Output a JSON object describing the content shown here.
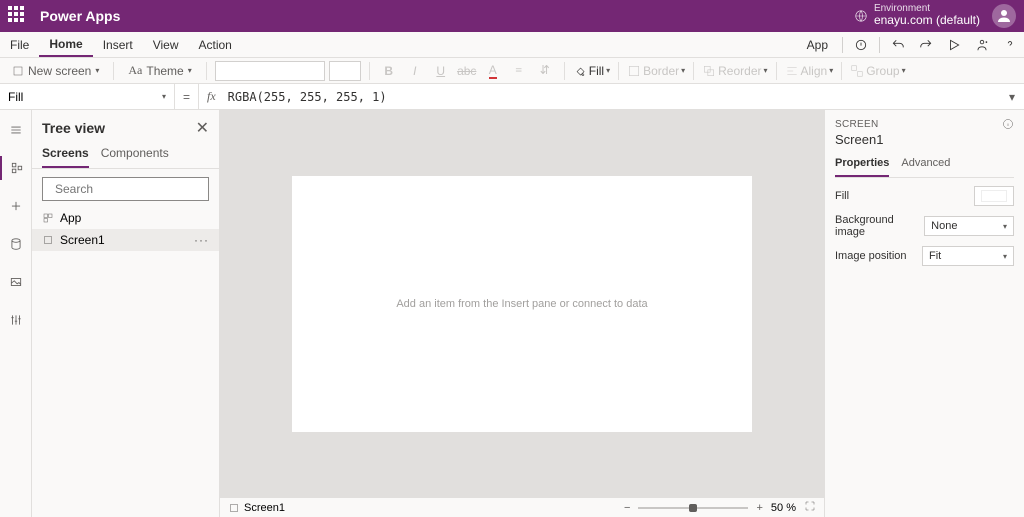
{
  "titlebar": {
    "brand": "Power Apps",
    "env_label": "Environment",
    "env_name": "enayu.com (default)"
  },
  "menubar": {
    "items": [
      "File",
      "Home",
      "Insert",
      "View",
      "Action"
    ],
    "active": 1,
    "app": "App"
  },
  "toolbar": {
    "new_screen": "New screen",
    "theme": "Theme",
    "fill": "Fill",
    "border": "Border",
    "reorder": "Reorder",
    "align": "Align",
    "group": "Group"
  },
  "formula": {
    "prop": "Fill",
    "fx": "fx",
    "value": "RGBA(255, 255, 255, 1)"
  },
  "tree": {
    "title": "Tree view",
    "tabs": [
      "Screens",
      "Components"
    ],
    "search_placeholder": "Search",
    "nodes": [
      "App",
      "Screen1"
    ]
  },
  "canvas": {
    "hint": "Add an item from the Insert pane or connect to data"
  },
  "status": {
    "screen": "Screen1",
    "zoom": "50 %"
  },
  "props": {
    "heading": "SCREEN",
    "name": "Screen1",
    "tabs": [
      "Properties",
      "Advanced"
    ],
    "fill": "Fill",
    "bgimg": "Background image",
    "bgimg_val": "None",
    "imgpos": "Image position",
    "imgpos_val": "Fit"
  }
}
